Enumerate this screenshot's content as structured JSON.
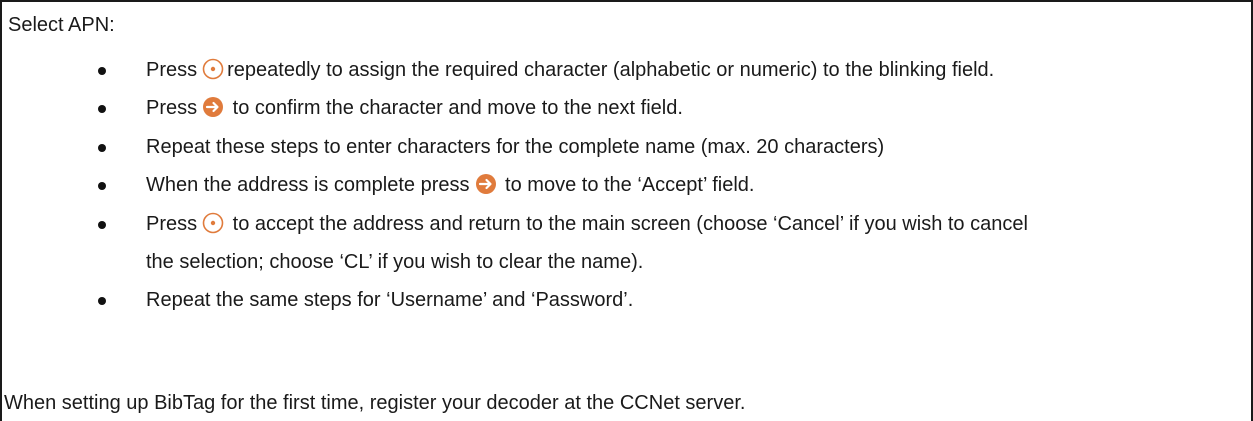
{
  "heading": "Select APN:",
  "bullets": [
    {
      "prefix": "Press",
      "icon": "select-button-icon",
      "suffix": "repeatedly to assign the required character (alphabetic or numeric) to the blinking field."
    },
    {
      "prefix": "Press",
      "icon": "arrow-right-icon",
      "suffix": " to confirm the character and move to the next field."
    },
    {
      "text": "Repeat these steps to enter characters for the complete name (max. 20 characters)"
    },
    {
      "prefix": "When the address is complete press",
      "icon": "arrow-right-icon",
      "suffix": " to move to the ‘Accept’ field."
    },
    {
      "prefix": "Press",
      "icon": "select-button-icon",
      "suffix": " to accept the address and return to the main screen (choose ‘Cancel’ if you wish to cancel",
      "continuation": "the selection; choose ‘CL’ if you wish to clear the name)."
    },
    {
      "text": "Repeat the same steps for ‘Username’ and ‘Password’."
    }
  ],
  "footer": "When setting up BibTag for the first time, register your decoder at the CCNet server.",
  "colors": {
    "icon_accent": "#e07b3c",
    "text": "#1a1a1a"
  }
}
